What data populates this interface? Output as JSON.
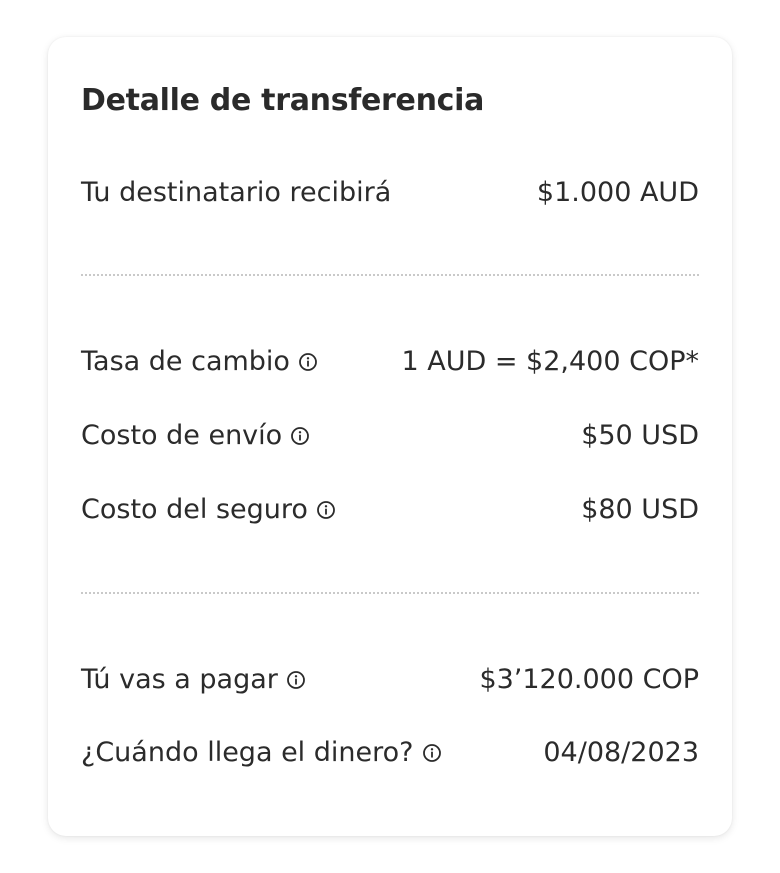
{
  "card": {
    "title": "Detalle de transferencia"
  },
  "rows": {
    "recipient": {
      "label": "Tu destinatario recibirá",
      "value": "$1.000 AUD",
      "info": false
    },
    "exchange_rate": {
      "label": "Tasa de cambio",
      "value": "1 AUD = $2,400 COP*",
      "info": true
    },
    "shipping_cost": {
      "label": "Costo de envío",
      "value": "$50 USD",
      "info": true
    },
    "insurance_cost": {
      "label": "Costo del seguro",
      "value": "$80 USD",
      "info": true
    },
    "total": {
      "label": "Tú vas a pagar",
      "value": "$3’120.000 COP",
      "info": true
    },
    "arrival": {
      "label": "¿Cuándo llega el dinero?",
      "value": "04/08/2023",
      "info": true
    }
  },
  "icons": {
    "info": "info-circle-icon"
  },
  "colors": {
    "text": "#2b2b2b",
    "divider": "#c9c9c9",
    "card_background": "#ffffff"
  }
}
